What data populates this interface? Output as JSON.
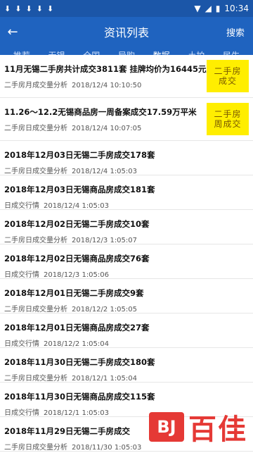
{
  "status": {
    "time": "10:34"
  },
  "app": {
    "title": "资讯列表",
    "search_label": "搜索",
    "back_icon": "←"
  },
  "tabs": [
    "推荐",
    "无锡",
    "全国",
    "导购",
    "数据",
    "土拍",
    "民生"
  ],
  "active_tab": "数据",
  "items": [
    {
      "title": "11月无锡二手房共计成交3811套 挂牌均价为16445元/平",
      "category": "二手房月成交量分析",
      "date": "2018/12/4 10:10:50",
      "thumb": "二手房\n成交"
    },
    {
      "title": "11.26～12.2无锡商品房一周备案成交17.59万平米",
      "category": "二手房日成交量分析",
      "date": "2018/12/4 10:07:05",
      "thumb": "二手房\n周成交"
    },
    {
      "title": "2018年12月03日无锡二手房成交178套",
      "category": "二手房日成交量分析",
      "date": "2018/12/4 1:05:03"
    },
    {
      "title": "2018年12月03日无锡商品房成交181套",
      "category": "日成交行情",
      "date": "2018/12/4 1:05:03"
    },
    {
      "title": "2018年12月02日无锡二手房成交10套",
      "category": "二手房日成交量分析",
      "date": "2018/12/3 1:05:07"
    },
    {
      "title": "2018年12月02日无锡商品房成交76套",
      "category": "日成交行情",
      "date": "2018/12/3 1:05:06"
    },
    {
      "title": "2018年12月01日无锡二手房成交9套",
      "category": "二手房日成交量分析",
      "date": "2018/12/2 1:05:05"
    },
    {
      "title": "2018年12月01日无锡商品房成交27套",
      "category": "日成交行情",
      "date": "2018/12/2 1:05:04"
    },
    {
      "title": "2018年11月30日无锡二手房成交180套",
      "category": "二手房日成交量分析",
      "date": "2018/12/1 1:05:04"
    },
    {
      "title": "2018年11月30日无锡商品房成交115套",
      "category": "日成交行情",
      "date": "2018/12/1 1:05:03"
    },
    {
      "title": "2018年11月29日无锡二手房成交",
      "category": "二手房日成交量分析",
      "date": "2018/11/30 1:05:03"
    }
  ],
  "watermark": {
    "logo": "BJ",
    "text": "百佳"
  }
}
